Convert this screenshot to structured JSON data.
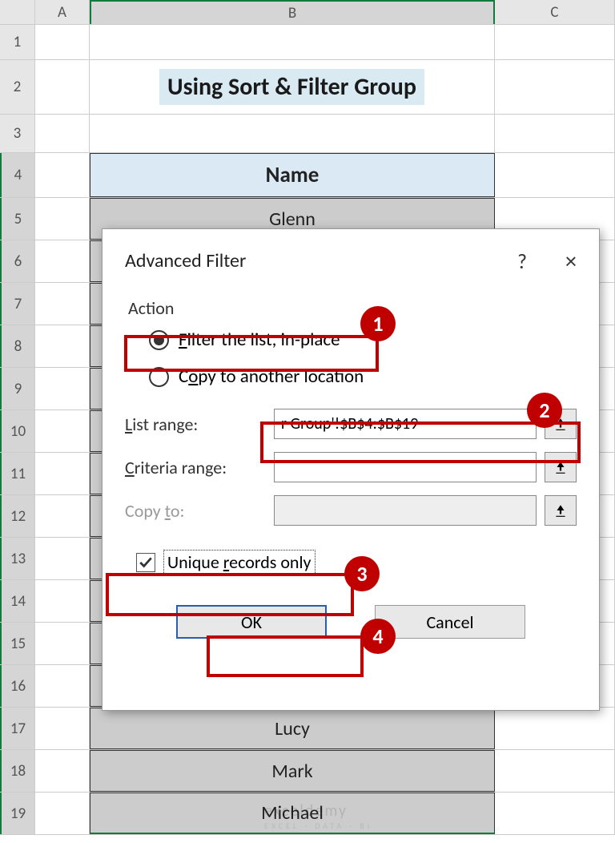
{
  "columns": {
    "A": "A",
    "B": "B",
    "C": "C"
  },
  "rows": [
    "1",
    "2",
    "3",
    "4",
    "5",
    "6",
    "7",
    "8",
    "9",
    "10",
    "11",
    "12",
    "13",
    "14",
    "15",
    "16",
    "17",
    "18",
    "19"
  ],
  "title": "Using Sort & Filter Group",
  "table_header": "Name",
  "names": [
    "Glenn",
    "",
    "",
    "",
    "",
    "",
    "",
    "",
    "",
    "",
    "",
    "",
    "Lucy",
    "Mark",
    "Michael"
  ],
  "dialog": {
    "title": "Advanced Filter",
    "help": "?",
    "close": "×",
    "action_label": "Action",
    "radio1": "Filter the list, in-place",
    "radio2": "Copy to another location",
    "list_range_label": "List range:",
    "list_range_value": "r Group'!$B$4:$B$19",
    "criteria_label": "Criteria range:",
    "criteria_value": "",
    "copyto_label": "Copy to:",
    "copyto_value": "",
    "unique_label": "Unique records only",
    "ok": "OK",
    "cancel": "Cancel"
  },
  "badges": {
    "b1": "1",
    "b2": "2",
    "b3": "3",
    "b4": "4"
  },
  "watermark": "exceldemy",
  "watermark_sub": "EXCEL · DATA · BI"
}
